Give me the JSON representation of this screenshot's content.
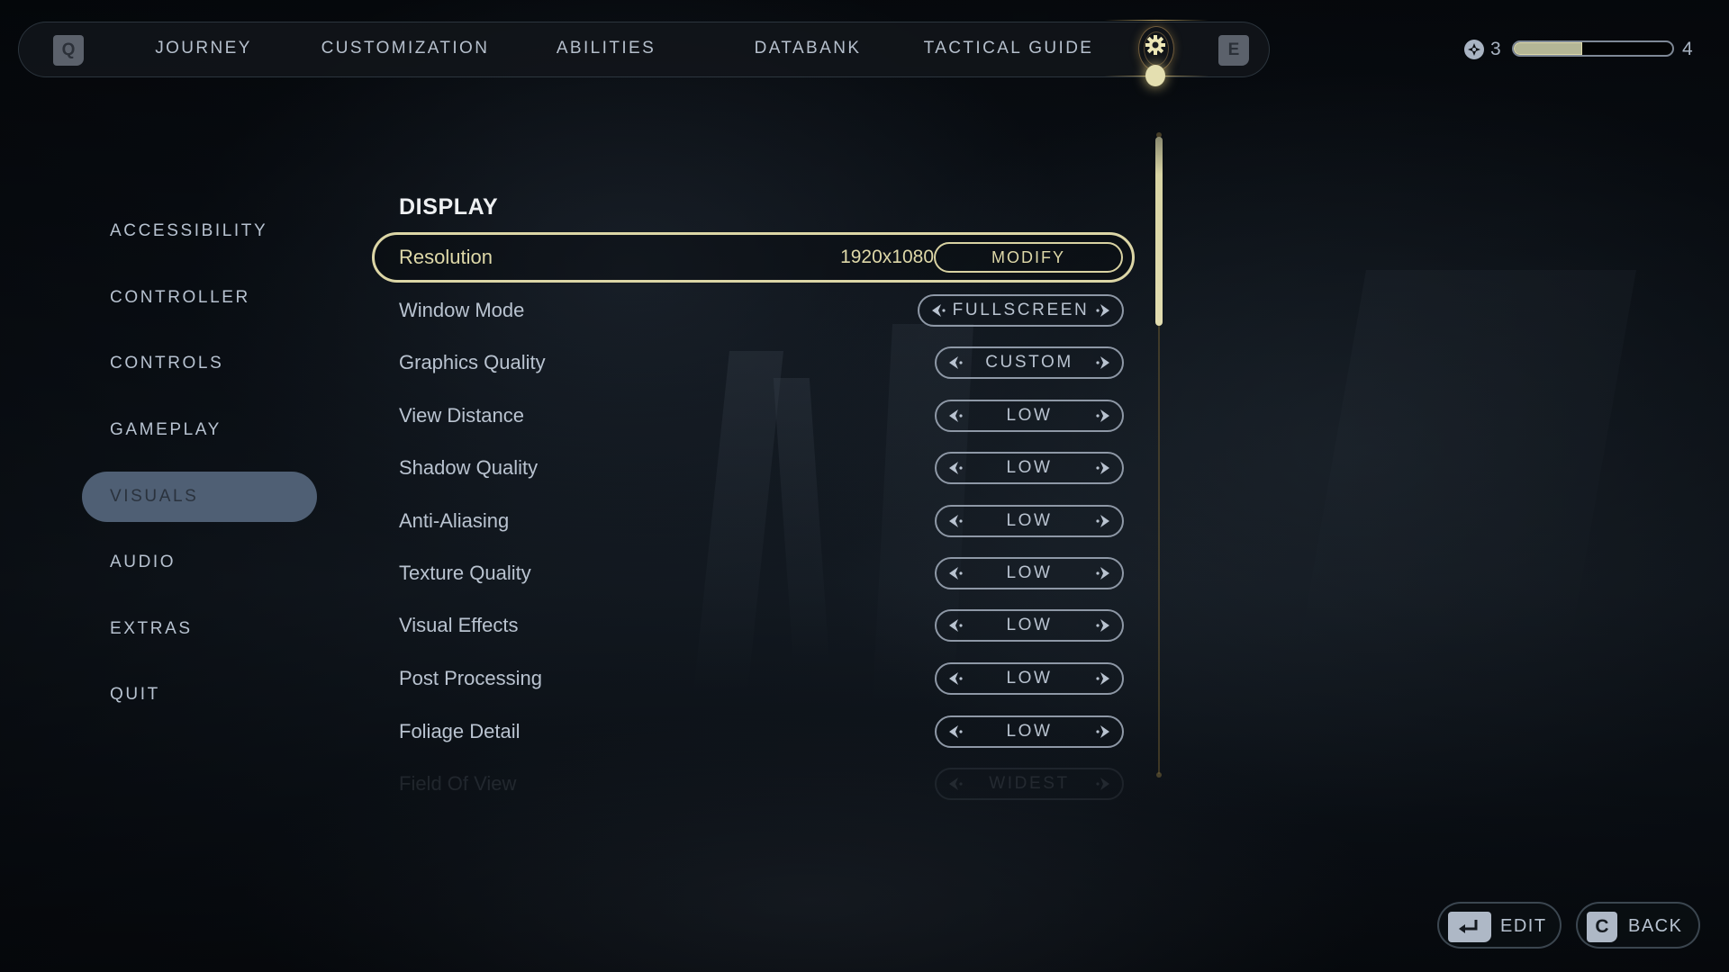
{
  "topnav": {
    "left_key": "Q",
    "right_key": "E",
    "tabs": [
      {
        "label": "JOURNEY"
      },
      {
        "label": "CUSTOMIZATION"
      },
      {
        "label": "ABILITIES"
      },
      {
        "label": "DATABANK"
      },
      {
        "label": "TACTICAL GUIDE"
      }
    ],
    "active_tab_icon": "gear-icon",
    "accent_color": "#e4dfb0"
  },
  "progress": {
    "icon": "skill-point-icon",
    "current_level": "3",
    "next_level": "4",
    "fill_fraction": 0.43
  },
  "sidebar": {
    "items": [
      {
        "label": "ACCESSIBILITY"
      },
      {
        "label": "CONTROLLER"
      },
      {
        "label": "CONTROLS"
      },
      {
        "label": "GAMEPLAY"
      },
      {
        "label": "VISUALS",
        "active": true
      },
      {
        "label": "AUDIO"
      },
      {
        "label": "EXTRAS"
      },
      {
        "label": "QUIT"
      }
    ]
  },
  "main": {
    "section_title": "DISPLAY",
    "resolution": {
      "label": "Resolution",
      "value": "1920x1080",
      "button": "MODIFY"
    },
    "settings": [
      {
        "label": "Window Mode",
        "value": "FULLSCREEN"
      },
      {
        "label": "Graphics Quality",
        "value": "CUSTOM"
      },
      {
        "label": "View Distance",
        "value": "LOW"
      },
      {
        "label": "Shadow Quality",
        "value": "LOW"
      },
      {
        "label": "Anti-Aliasing",
        "value": "LOW"
      },
      {
        "label": "Texture Quality",
        "value": "LOW"
      },
      {
        "label": "Visual Effects",
        "value": "LOW"
      },
      {
        "label": "Post Processing",
        "value": "LOW"
      },
      {
        "label": "Foliage Detail",
        "value": "LOW"
      },
      {
        "label": "Field Of View",
        "value": "WIDEST"
      }
    ],
    "highlight_color": "#dcd6a6"
  },
  "bottom": {
    "edit": {
      "key": "enter-key-icon",
      "label": "EDIT"
    },
    "back": {
      "key": "C",
      "label": "BACK"
    }
  }
}
